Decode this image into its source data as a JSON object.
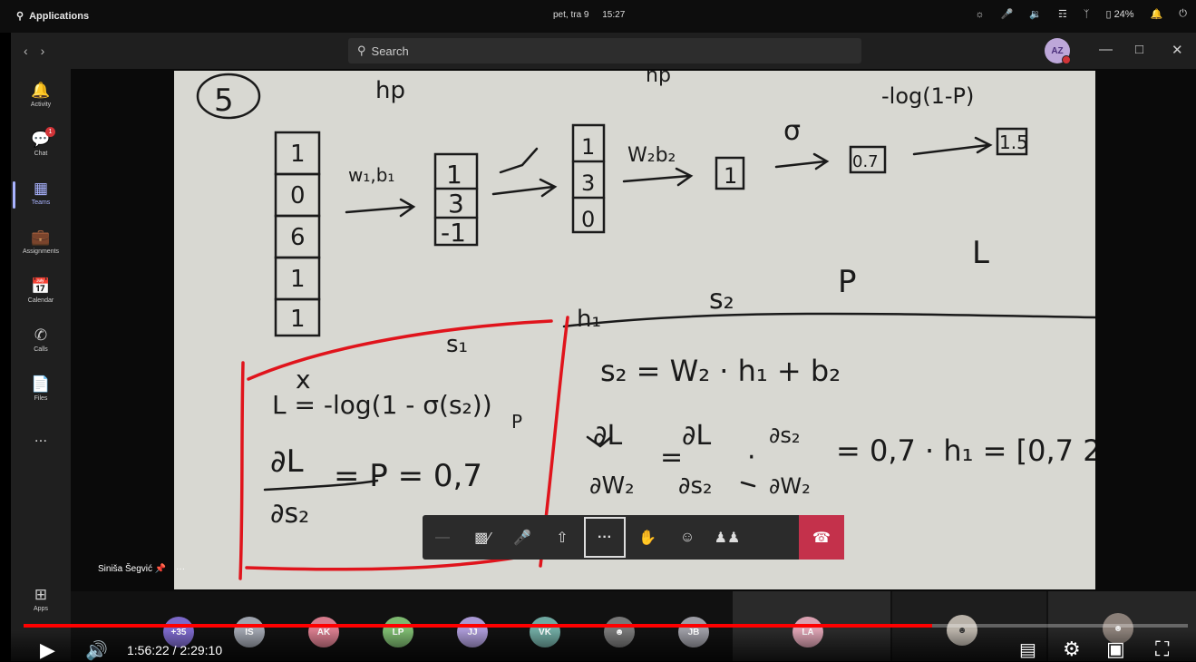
{
  "os_bar": {
    "apps_label": "Applications",
    "date": "pet, tra  9",
    "time": "15:27",
    "battery": "24%"
  },
  "header": {
    "search_placeholder": "Search",
    "avatar_initials": "AZ"
  },
  "rail": {
    "items": [
      {
        "label": "Activity",
        "icon": "bell-icon"
      },
      {
        "label": "Chat",
        "icon": "chat-icon",
        "badge": "1"
      },
      {
        "label": "Teams",
        "icon": "teams-icon"
      },
      {
        "label": "Assignments",
        "icon": "assignments-icon"
      },
      {
        "label": "Calendar",
        "icon": "calendar-icon"
      },
      {
        "label": "Calls",
        "icon": "phone-icon"
      },
      {
        "label": "Files",
        "icon": "file-icon"
      },
      {
        "label": "...",
        "icon": "more-icon"
      },
      {
        "label": "Apps",
        "icon": "apps-icon"
      }
    ],
    "active": "Teams"
  },
  "stage": {
    "speaker_name": "Siniša Šegvić",
    "whiteboard": {
      "t_five": "5",
      "t_hp1": "hp",
      "t_hp2": "hp",
      "t_loss_top": "-log(1-P)",
      "t_w1b1": "w₁,b₁",
      "t_relu": "_/",
      "t_w2b2": "W₂b₂",
      "t_sigma": "σ",
      "t_v1": [
        "1",
        "0",
        "6",
        "1",
        "1"
      ],
      "t_v2": [
        "1",
        "3",
        "-1"
      ],
      "t_v3": [
        "1",
        "3",
        "0"
      ],
      "t_box1": "1",
      "t_box2": "0.7",
      "t_box3": "1.5",
      "t_L": "L",
      "t_P": "P",
      "t_s2_label": "s₂",
      "t_h1": "h₁",
      "t_s1": "s₁",
      "t_x": "x",
      "t_eq1": "L = -log(1 - σ(s₂))",
      "t_P_small": "P",
      "t_eq2_num": "∂L",
      "t_eq2_den": "∂s₂",
      "t_eq2_rhs": "= P = 0,7",
      "t_s2_eq": "s₂ = W₂ · h₁ + b₂",
      "t_grad_num1": "∂L",
      "t_grad_den1": "∂W₂",
      "t_grad_num2": "∂L",
      "t_grad_den2": "∂s₂",
      "t_grad_num3": "∂s₂",
      "t_grad_den3": "∂W₂",
      "t_grad_rhs": "= 0,7 · h₁ = [0,7 2"
    }
  },
  "call_controls": {
    "buttons": [
      {
        "name": "separator",
        "icon": "—"
      },
      {
        "name": "camera-off",
        "icon": "camera-off-icon"
      },
      {
        "name": "mic-off",
        "icon": "mic-off-icon"
      },
      {
        "name": "share",
        "icon": "share-icon"
      },
      {
        "name": "more",
        "icon": "···"
      },
      {
        "name": "raise-hand",
        "icon": "hand-icon"
      },
      {
        "name": "reactions",
        "icon": "reactions-icon"
      },
      {
        "name": "people",
        "icon": "people-icon"
      },
      {
        "name": "hang-up",
        "icon": "hangup-icon"
      }
    ]
  },
  "participants": {
    "overflow": "+35",
    "initials": [
      "IS",
      "AK",
      "LP",
      "JJ",
      "VK",
      "",
      "JB",
      "LA"
    ],
    "colors": [
      "#7b68c8",
      "#9ea3ad",
      "#d67b8c",
      "#7cb86f",
      "#a998d4",
      "#6fa8a0",
      "#777",
      "#9c9ca4",
      "#d9a0b0"
    ]
  },
  "video_player": {
    "time_current": "1:56:22",
    "time_total": "2:29:10",
    "progress": 0.78
  }
}
